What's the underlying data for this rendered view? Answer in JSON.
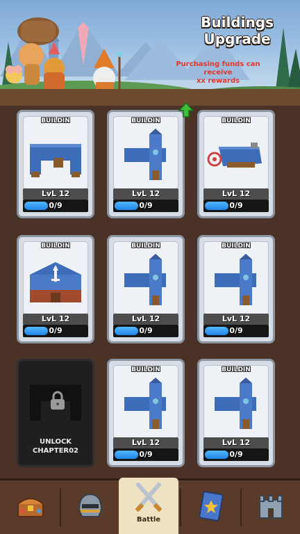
{
  "header": {
    "title_line1": "Buildings",
    "title_line2": "Upgrade",
    "subtitle_line1": "Purchasing funds can receive",
    "subtitle_line2": "xx rewards"
  },
  "cards": [
    {
      "label": "BUILDIN",
      "level": "LvL 12",
      "progress": "0/9",
      "fill_fraction": 0.35,
      "art": "barracks"
    },
    {
      "label": "BUILDIN",
      "level": "LvL 12",
      "progress": "0/9",
      "fill_fraction": 0.35,
      "art": "tower-wall",
      "upgrade_arrow": true
    },
    {
      "label": "BUILDIN",
      "level": "LvL 12",
      "progress": "0/9",
      "fill_fraction": 0.35,
      "art": "archery-range"
    },
    {
      "label": "BUILDIN",
      "level": "LvL 12",
      "progress": "0/9",
      "fill_fraction": 0.35,
      "art": "sword-hall"
    },
    {
      "label": "BUILDIN",
      "level": "LvL 12",
      "progress": "0/9",
      "fill_fraction": 0.35,
      "art": "tower-wall"
    },
    {
      "label": "BUILDIN",
      "level": "LvL 12",
      "progress": "0/9",
      "fill_fraction": 0.35,
      "art": "tower-wall"
    },
    {
      "locked": true,
      "unlock_line1": "UNLOCK",
      "unlock_line2": "CHAPTER02",
      "icon": "lock-icon"
    },
    {
      "label": "BUILDIN",
      "level": "LvL 12",
      "progress": "0/9",
      "fill_fraction": 0.35,
      "art": "tower-wall"
    },
    {
      "label": "BUILDIN",
      "level": "LvL 12",
      "progress": "0/9",
      "fill_fraction": 0.35,
      "art": "tower-wall"
    }
  ],
  "nav": {
    "items": [
      {
        "name": "shop",
        "icon": "treasure-chest-icon"
      },
      {
        "name": "heroes",
        "icon": "knight-helmet-icon"
      },
      {
        "name": "battle",
        "icon": "crossed-swords-icon",
        "label": "Battle",
        "active": true
      },
      {
        "name": "cards",
        "icon": "card-icon"
      },
      {
        "name": "castle",
        "icon": "castle-icon"
      }
    ]
  },
  "colors": {
    "background": "#4a3226",
    "progress_fill": "#2b8ef0",
    "subtitle": "#e6352a",
    "upgrade_arrow": "#3fbf3a"
  }
}
